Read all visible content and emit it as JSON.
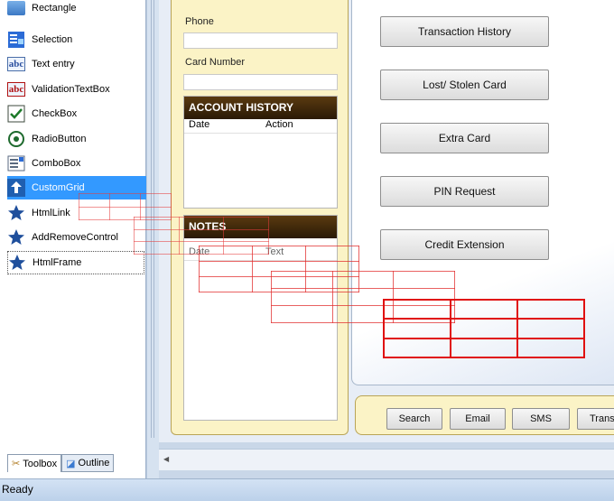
{
  "toolbox": {
    "items": [
      {
        "label": "Rectangle",
        "icon": "rectangle-icon"
      },
      {
        "label": "Selection",
        "icon": "selection-icon"
      },
      {
        "label": "Text entry",
        "icon": "text-entry-icon"
      },
      {
        "label": "ValidationTextBox",
        "icon": "validation-textbox-icon"
      },
      {
        "label": "CheckBox",
        "icon": "checkbox-icon"
      },
      {
        "label": "RadioButton",
        "icon": "radiobutton-icon"
      },
      {
        "label": "ComboBox",
        "icon": "combobox-icon"
      },
      {
        "label": "CustomGrid",
        "icon": "customgrid-icon",
        "selected": true
      },
      {
        "label": "HtmlLink",
        "icon": "star-icon"
      },
      {
        "label": "AddRemoveControl",
        "icon": "star-icon"
      },
      {
        "label": "HtmlFrame",
        "icon": "star-icon"
      }
    ],
    "tabs": [
      {
        "label": "Toolbox",
        "icon": "tools-icon",
        "active": true
      },
      {
        "label": "Outline",
        "icon": "outline-icon",
        "active": false
      }
    ]
  },
  "form": {
    "phone_label": "Phone",
    "card_label": "Card Number",
    "account_history": {
      "title": "ACCOUNT HISTORY",
      "columns": [
        "Date",
        "Action"
      ]
    },
    "notes": {
      "title": "NOTES",
      "columns": [
        "Date",
        "Text"
      ]
    }
  },
  "actions": {
    "buttons": [
      "Transaction History",
      "Lost/ Stolen Card",
      "Extra Card",
      "PIN Request",
      "Credit Extension"
    ]
  },
  "bottom_buttons": [
    "Search",
    "Email",
    "SMS",
    "Trans"
  ],
  "status": {
    "text": "Ready"
  },
  "colors": {
    "selection": "#3399ff",
    "panel": "#fbf3c6",
    "grid_red": "#e01010",
    "header_brown": "#3a2408"
  }
}
